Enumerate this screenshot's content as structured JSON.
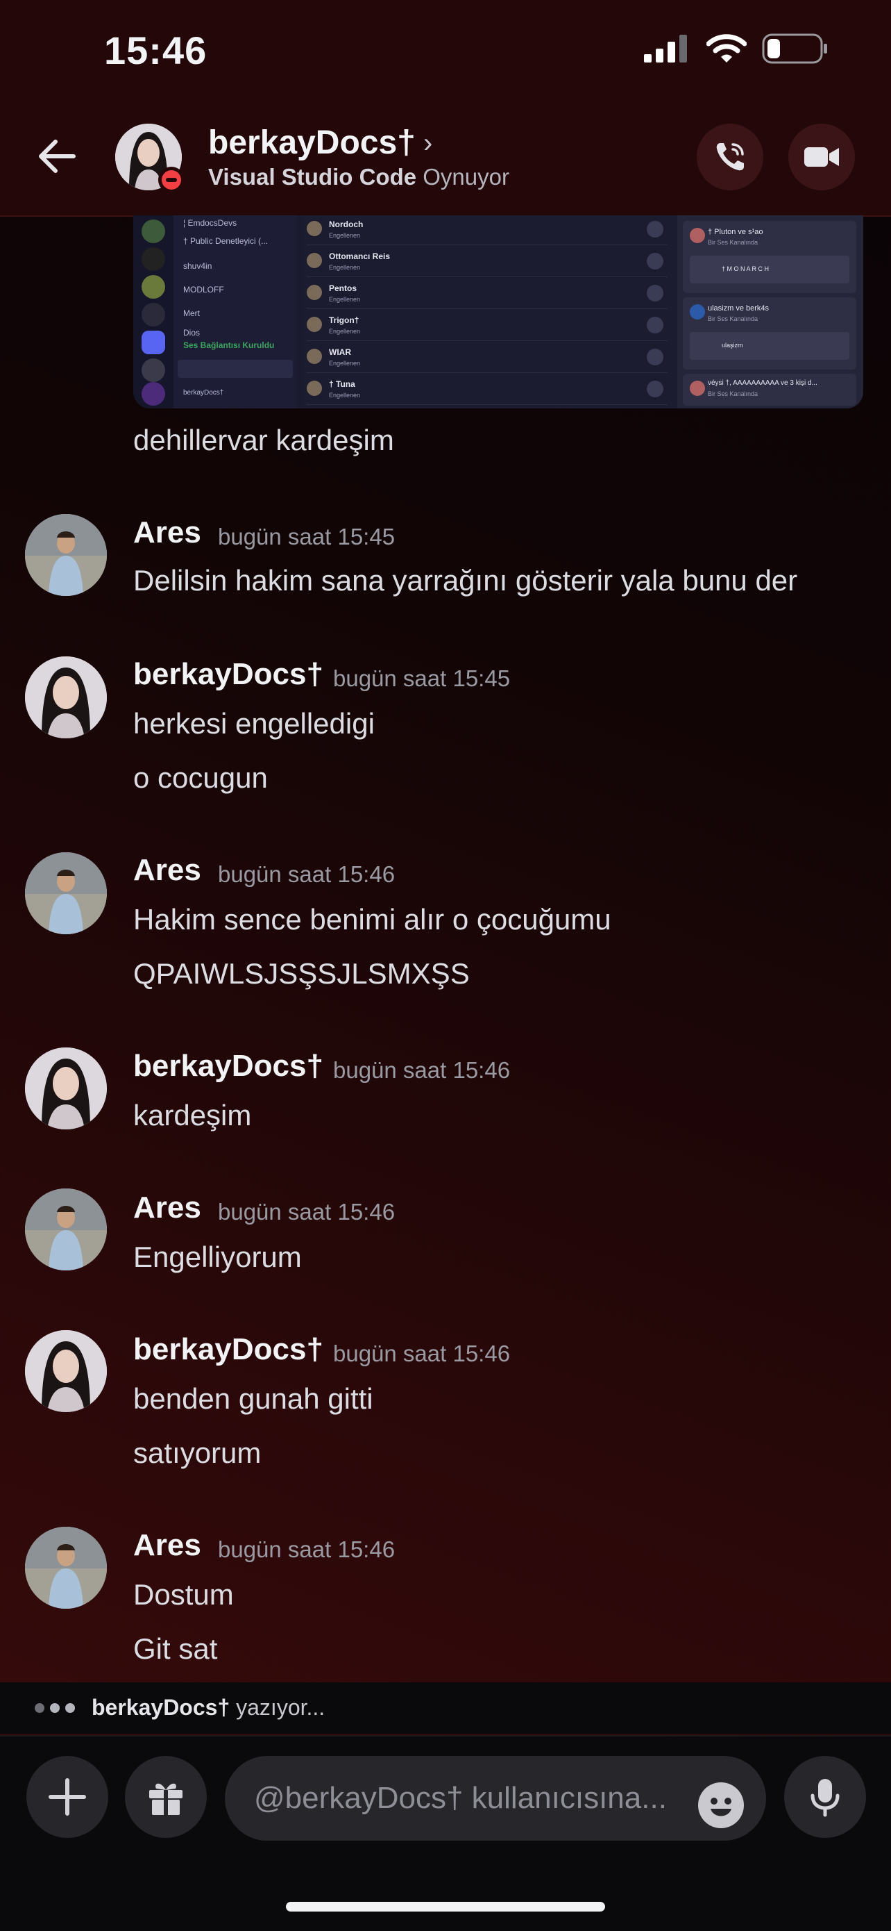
{
  "status_bar": {
    "time": "15:46"
  },
  "header": {
    "username": "berkayDocs†",
    "activity_app": "Visual Studio Code",
    "activity_verb": "Oynuyor"
  },
  "embed": {
    "channels": [
      "¦ EmdocsDevs",
      "† Public Denetleyici (...",
      "shuv4in",
      "MODLOFF",
      "Mert",
      "Dios"
    ],
    "voice_label": "Ses Bağlantısı Kuruldu",
    "self_name": "berkayDocs†",
    "rows": [
      {
        "name": "Nordoch",
        "status": "Engellenen"
      },
      {
        "name": "Ottomancı Reis",
        "status": "Engellenen"
      },
      {
        "name": "Pentos",
        "status": "Engellenen"
      },
      {
        "name": "Trigon†",
        "status": "Engellenen"
      },
      {
        "name": "WIAR",
        "status": "Engellenen"
      },
      {
        "name": "† Tuna",
        "status": "Engellenen"
      }
    ],
    "cards": [
      {
        "title": "† Pluton ve s¹ao",
        "sub": "Bir Ses Kanalında",
        "item": "† M O N A R C H"
      },
      {
        "title": "ulasizm ve berk4s",
        "sub": "Bir Ses Kanalında",
        "item": "ulaşizm"
      },
      {
        "title": "véysi †, AAAAAAAAAA ve 3 kişi d...",
        "sub": "Bir Ses Kanalında",
        "item": ""
      }
    ]
  },
  "caption": "dehillervar kardeşim",
  "messages": [
    {
      "author": "Ares",
      "time": "bugün saat 15:45",
      "lines": [
        "Delilsin hakim sana yarrağını gösterir yala bunu der"
      ]
    },
    {
      "author": "berkayDocs†",
      "time": "bugün saat 15:45",
      "lines": [
        "herkesi engelledigi",
        "o cocugun"
      ]
    },
    {
      "author": "Ares",
      "time": "bugün saat 15:46",
      "lines": [
        "Hakim sence benimi alır o çocuğumu",
        "QPAIWLSJSŞSJLSMXŞS"
      ]
    },
    {
      "author": "berkayDocs†",
      "time": "bugün saat 15:46",
      "lines": [
        "kardeşim"
      ]
    },
    {
      "author": "Ares",
      "time": "bugün saat 15:46",
      "lines": [
        "Engelliyorum"
      ]
    },
    {
      "author": "berkayDocs†",
      "time": "bugün saat 15:46",
      "lines": [
        "benden gunah gitti",
        "satıyorum"
      ]
    },
    {
      "author": "Ares",
      "time": "bugün saat 15:46",
      "lines": [
        "Dostum",
        "Git sat"
      ]
    }
  ],
  "typing": {
    "user": "berkayDocs†",
    "suffix": "yazıyor..."
  },
  "input": {
    "placeholder": "@berkayDocs† kullanıcısına..."
  }
}
